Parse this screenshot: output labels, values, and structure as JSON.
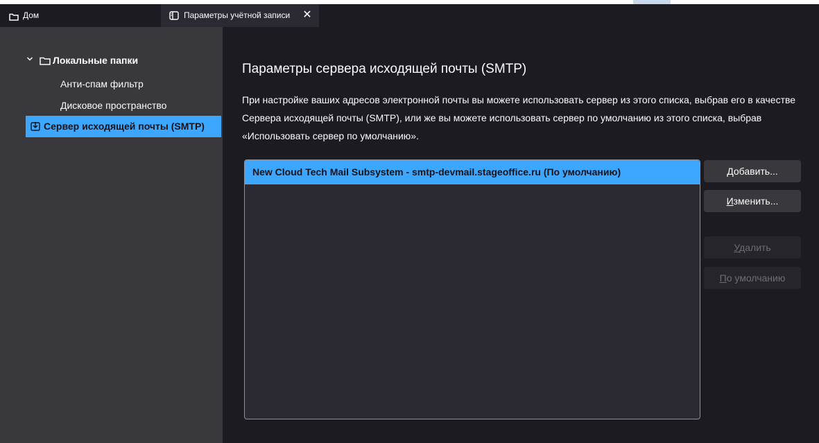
{
  "tabs": {
    "home_label": "Дом",
    "active_label": "Параметры учётной записи",
    "close_glyph": "✕"
  },
  "sidebar": {
    "root_label": "Локальные папки",
    "items": [
      {
        "label": "Анти-спам фильтр"
      },
      {
        "label": "Дисковое пространство"
      }
    ],
    "selected_label": "Сервер исходящей почты (SMTP)"
  },
  "main": {
    "title": "Параметры сервера исходящей почты (SMTP)",
    "description": "При настройке ваших адресов электронной почты вы можете использовать сервер из этого списка, выбрав его в качестве Сервера исходящей почты (SMTP), или же вы можете использовать сервер по умолчанию из этого списка, выбрав «Использовать сервер по умолчанию».",
    "servers": [
      {
        "label": "New Cloud Tech Mail Subsystem - smtp-devmail.stageoffice.ru (По умолчанию)"
      }
    ],
    "buttons": {
      "add_rest": "обавить...",
      "add_key": "Д",
      "edit_key": "И",
      "edit_rest": "зменить...",
      "delete_key": "У",
      "delete_rest": "далить",
      "default_key": "П",
      "default_rest": "о умолчанию"
    }
  },
  "colors": {
    "accent": "#3da6ff",
    "background": "#1c1b22",
    "sidebar": "#38383d"
  }
}
